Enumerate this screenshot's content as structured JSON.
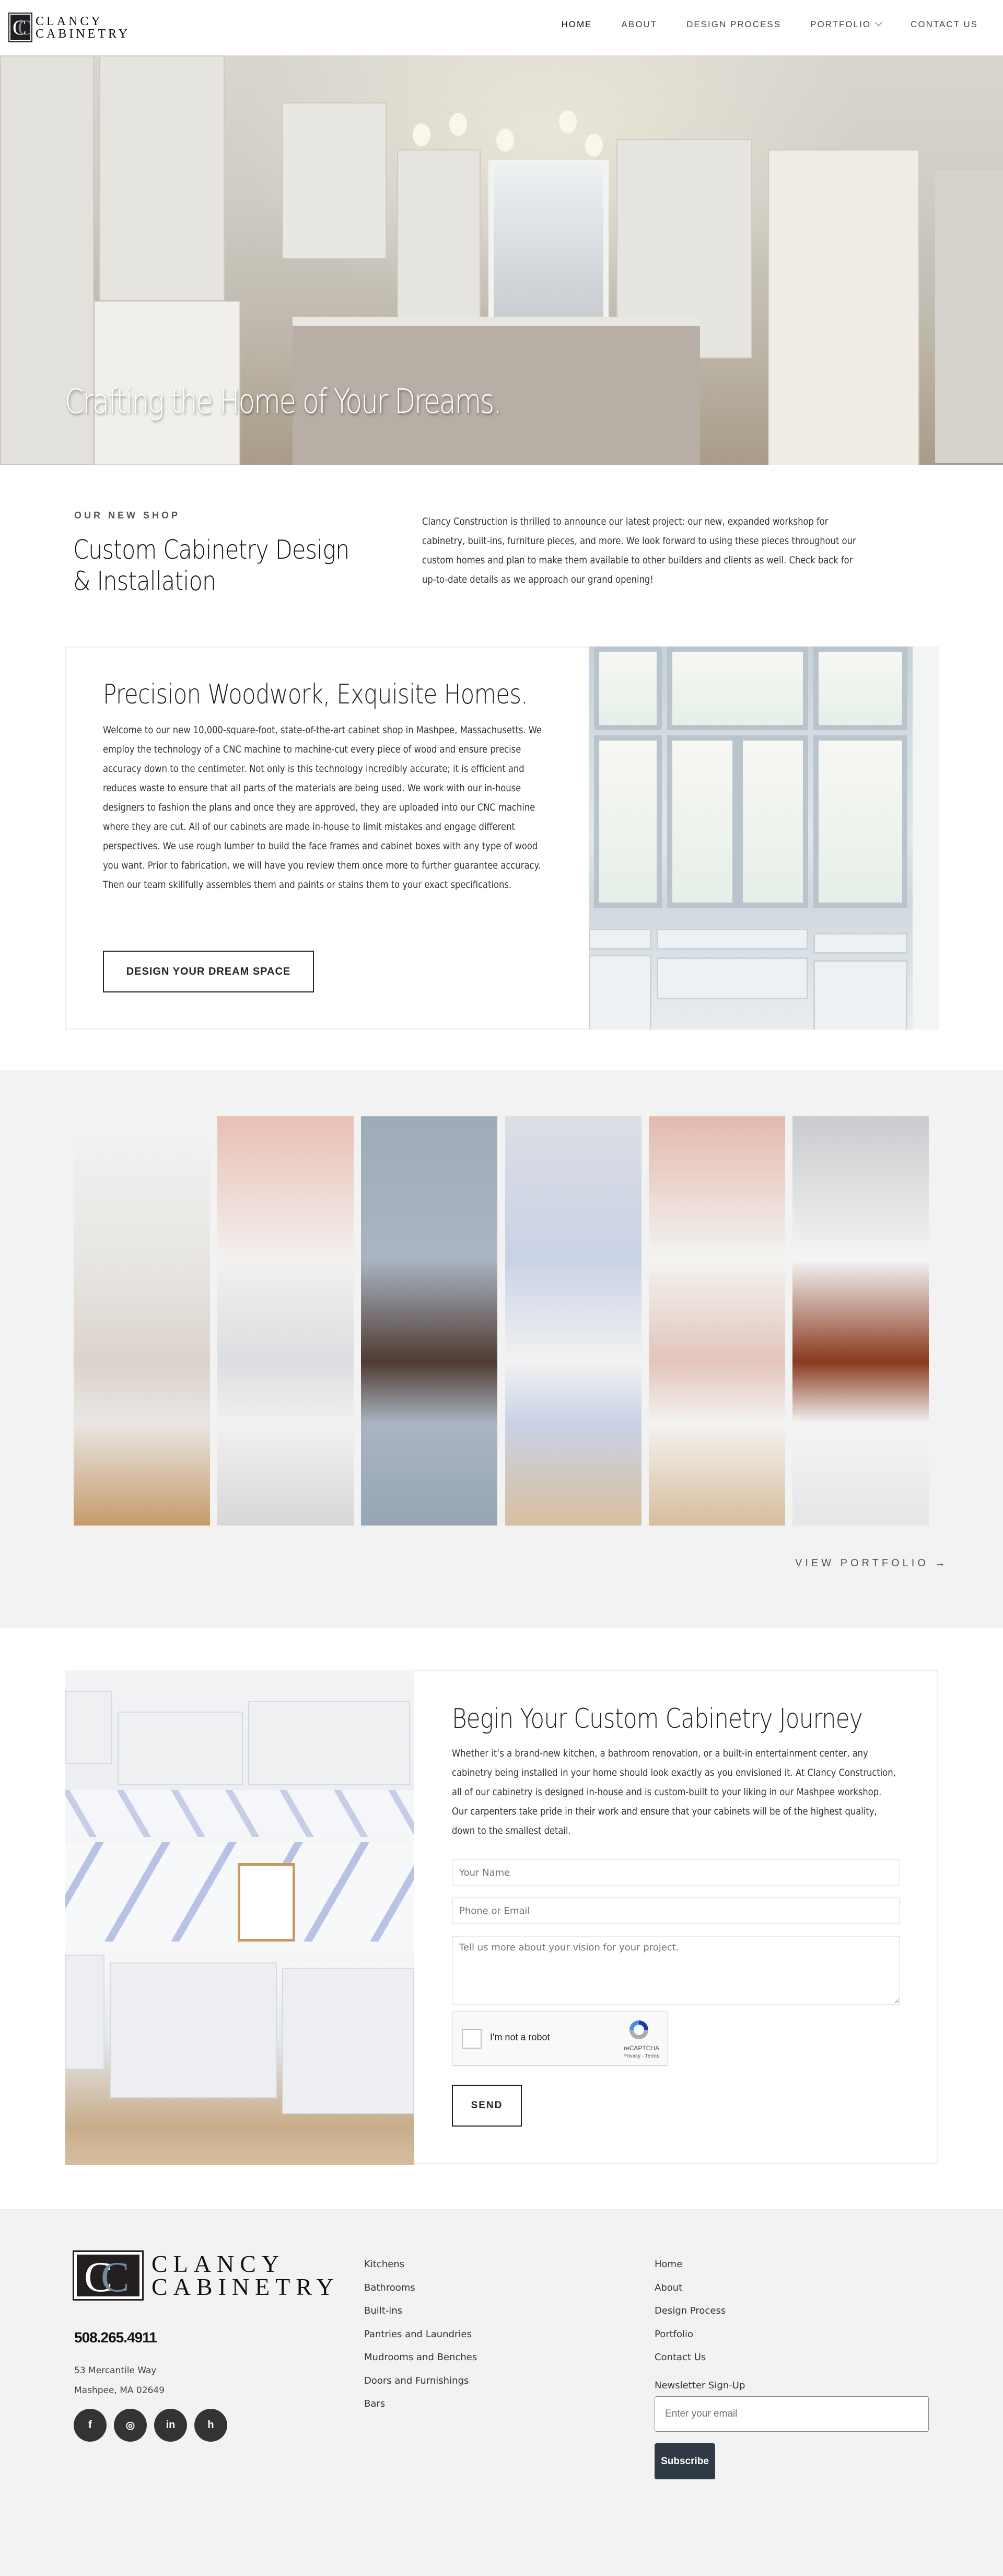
{
  "header": {
    "logo": {
      "mark": "CC",
      "line1": "CLANCY",
      "line2": "CABINETRY"
    },
    "nav": [
      {
        "label": "HOME",
        "active": true
      },
      {
        "label": "ABOUT"
      },
      {
        "label": "DESIGN PROCESS"
      },
      {
        "label": "PORTFOLIO",
        "has_dropdown": true
      },
      {
        "label": "CONTACT US"
      }
    ]
  },
  "hero": {
    "title": "Crafting the Home of Your Dreams.",
    "image": "kitchen-hero-photo"
  },
  "shop": {
    "eyebrow": "OUR NEW SHOP",
    "title": "Custom Cabinetry Design & Installation",
    "body": "Clancy Construction is thrilled to announce our latest project: our new, expanded workshop for cabinetry, built-ins, furniture pieces, and more. We look forward to using these pieces throughout our custom homes and plan to make them available to other builders and clients as well. Check back for up-to-date details as we approach our grand opening!"
  },
  "precision": {
    "title": "Precision Woodwork, Exquisite Homes.",
    "body": "Welcome to our new 10,000-square-foot, state-of-the-art cabinet shop in Mashpee, Massachusetts. We employ the technology of a CNC machine to machine-cut every piece of wood and ensure precise accuracy down to the centimeter. Not only is this technology incredibly accurate; it is efficient and reduces waste to ensure that all parts of the materials are being used. We work with our in-house designers to fashion the plans and once they are approved, they are uploaded into our CNC machine where they are cut. All of our cabinets are made in-house to limit mistakes and engage different perspectives. We use rough lumber to build the face frames and cabinet boxes with any type of wood you want. Prior to fabrication, we will have you review them once more to further guarantee accuracy. Then our team skillfully assembles them and paints or stains them to your exact specifications.",
    "button": "DESIGN YOUR DREAM SPACE",
    "image": "glass-cabinet-photo"
  },
  "portfolio": {
    "strips": [
      {
        "name": "kitchen-pendants-photo",
        "colors": [
          "#f3f3f2",
          "#e8e6e3",
          "#dcd3cc",
          "#c79a6c"
        ]
      },
      {
        "name": "pink-bathroom-vanity-photo",
        "colors": [
          "#e8bfb3",
          "#f2f1ef",
          "#dcdde0",
          "#d9d6d8"
        ]
      },
      {
        "name": "blue-gray-cabinet-photo",
        "colors": [
          "#9eabb8",
          "#a9b5c1",
          "#4f3b33",
          "#97a6b3"
        ]
      },
      {
        "name": "laundry-wallpaper-photo",
        "colors": [
          "#dcdee4",
          "#c9d2e6",
          "#f2f2f2",
          "#d8bf9f"
        ]
      },
      {
        "name": "window-seat-photo",
        "colors": [
          "#e4b9ad",
          "#f3f3f1",
          "#e3c4bc",
          "#d7bd9c"
        ]
      },
      {
        "name": "wood-front-door-photo",
        "colors": [
          "#c9cbce",
          "#f4f4f4",
          "#8a3a1f",
          "#e6e6e6"
        ]
      }
    ],
    "link": "VIEW PORTFOLIO",
    "link_icon": "arrow-right-icon"
  },
  "contact": {
    "title": "Begin Your Custom Cabinetry Journey",
    "body": "Whether it’s a brand-new kitchen, a bathroom renovation, or a built-in entertainment center, any cabinetry being installed in your home should look exactly as you envisioned it. At Clancy Construction, all of our cabinetry is designed in-house and is custom-built to your liking in our Mashpee workshop. Our carpenters take pride in their work and ensure that your cabinets will be of the highest quality, down to the smallest detail.",
    "image": "laundry-room-cabinets-photo",
    "fields": {
      "name_placeholder": "Your Name",
      "contact_placeholder": "Phone or Email",
      "message_placeholder": "Tell us more about your vision for your project.",
      "name_value": "",
      "contact_value": "",
      "message_value": ""
    },
    "captcha": {
      "label": "I'm not a robot",
      "brand": "reCAPTCHA",
      "links": "Privacy - Terms",
      "checked": false
    },
    "send": "SEND"
  },
  "footer": {
    "logo": {
      "mark": "CC",
      "line1": "CLANCY",
      "line2": "CABINETRY"
    },
    "phone": "508.265.4911",
    "address": [
      "53 Mercantile Way",
      "Mashpee, MA 02649"
    ],
    "socials": [
      {
        "name": "facebook-icon",
        "glyph": "f"
      },
      {
        "name": "instagram-icon",
        "glyph": "◎"
      },
      {
        "name": "linkedin-icon",
        "glyph": "in"
      },
      {
        "name": "houzz-icon",
        "glyph": "h"
      }
    ],
    "services": [
      "Kitchens",
      "Bathrooms",
      "Built-ins",
      "Pantries and Laundries",
      "Mudrooms and Benches",
      "Doors and Furnishings",
      "Bars"
    ],
    "links": [
      "Home",
      "About",
      "Design Process",
      "Portfolio",
      "Contact Us"
    ],
    "newsletter": {
      "label": "Newsletter Sign-Up",
      "placeholder": "Enter your email",
      "value": "",
      "button": "Subscribe"
    }
  },
  "colors": {
    "brand_dark": "#231f20",
    "brand_accent": "#6f8a99",
    "section_gray": "#f2f2f2",
    "subscribe_bg": "#2f3a45"
  }
}
